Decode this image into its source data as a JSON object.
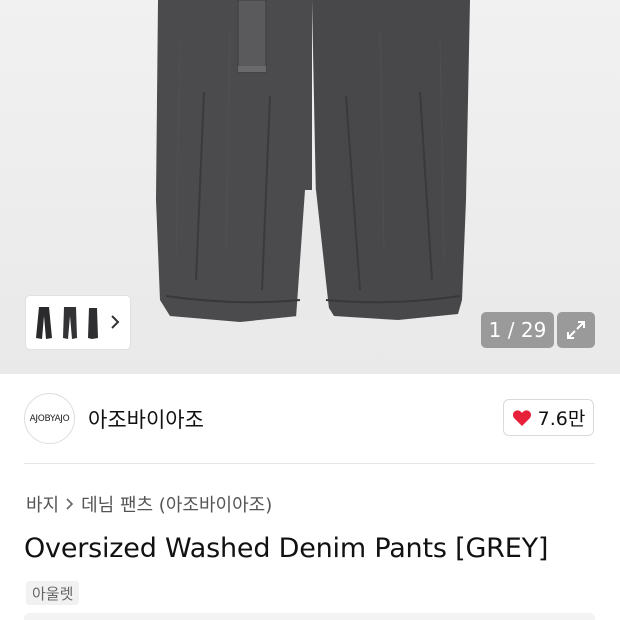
{
  "gallery": {
    "current": "1",
    "total": "29",
    "counter_text": "1 / 29",
    "thumbnail_count": 3
  },
  "brand": {
    "logo_text": "AJOBYAJO",
    "name": "아조바이아조",
    "likes": "7.6만"
  },
  "breadcrumb": {
    "category": "바지",
    "subcategory": "데님 팬츠 (아조바이아조)"
  },
  "product": {
    "title": "Oversized Washed Denim Pants [GREY]",
    "tag": "아울렛"
  },
  "colors": {
    "denim": "#4a4a4c",
    "like_heart": "#e8213a",
    "counter_bg": "#8c8c8c"
  }
}
